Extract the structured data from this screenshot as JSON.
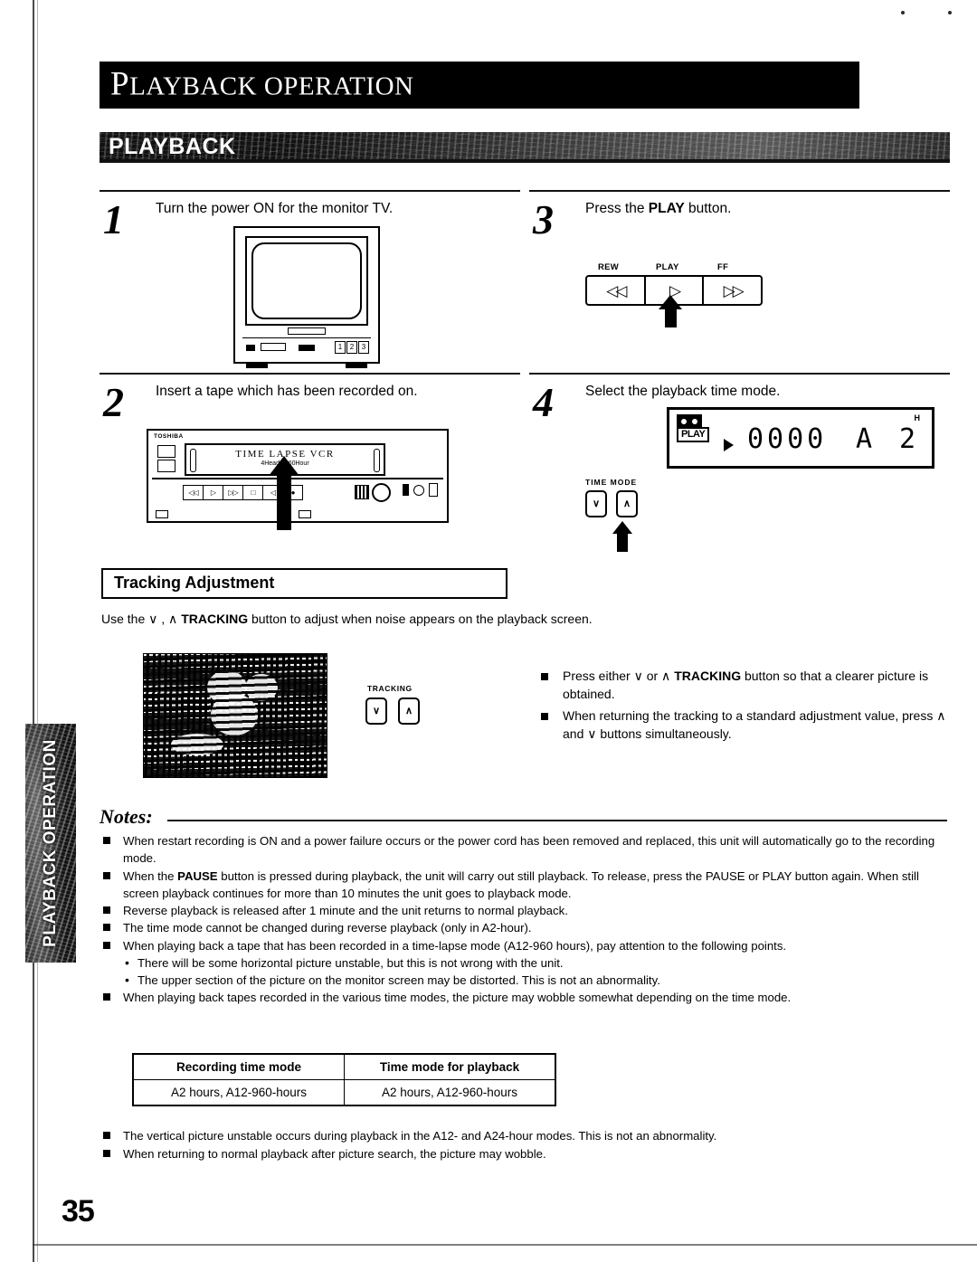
{
  "document": {
    "title": "PLAYBACK OPERATION",
    "title_first_letter": "P",
    "title_rest": "LAYBACK OPERATION",
    "section_bar_label": "PLAYBACK",
    "side_tab_label": "PLAYBACK OPERATION",
    "page_number": "35"
  },
  "steps": [
    {
      "number": "1",
      "caption": "Turn the power ON for the monitor TV.",
      "illustration": "monitor-tv",
      "tv_buttons": [
        "1",
        "2",
        "3"
      ]
    },
    {
      "number": "2",
      "caption": "Insert a tape which has been recorded on.",
      "illustration": "vcr-front-panel",
      "vcr": {
        "brand": "TOSHIBA",
        "slot_title": "TIME LAPSE VCR",
        "slot_subtitle": "4Head / 960Hour"
      }
    },
    {
      "number": "3",
      "caption_prefix": "Press the ",
      "caption_bold": "PLAY",
      "caption_suffix": " button.",
      "illustration": "transport-buttons",
      "transport": {
        "labels": [
          "REW",
          "PLAY",
          "FF"
        ],
        "glyphs": [
          "◁◁",
          "▷",
          "▷▷"
        ]
      }
    },
    {
      "number": "4",
      "caption": "Select the playback time mode.",
      "illustration": "lcd-display",
      "lcd": {
        "play_indicator": "PLAY",
        "counter": "0000",
        "mode_letter": "A",
        "mode_value": "2",
        "mode_unit": "H"
      },
      "time_mode": {
        "label": "TIME MODE",
        "down_glyph": "∨",
        "up_glyph": "∧"
      }
    }
  ],
  "tracking": {
    "heading": "Tracking Adjustment",
    "intro_part1": "Use the  ∨ ,  ∧  ",
    "intro_bold": "TRACKING",
    "intro_part2": " button to adjust when noise appears on the playback screen.",
    "button_label": "TRACKING",
    "down_glyph": "∨",
    "up_glyph": "∧",
    "bullets": [
      {
        "p1": "Press either  ∨  or  ∧  ",
        "b": "TRACKING",
        "p2": " button so that a clearer picture is obtained."
      },
      {
        "p1": "When returning the tracking to a standard adjustment value, press  ∧  and  ∨  buttons simultaneously.",
        "b": "",
        "p2": ""
      }
    ]
  },
  "notes": {
    "title": "Notes:",
    "items": [
      {
        "type": "bullet",
        "p1": "When restart recording is ON and a power failure occurs or the power cord has been removed and replaced, this unit will automatically go to the recording mode.",
        "b": "",
        "p2": ""
      },
      {
        "type": "bullet",
        "p1": "When the ",
        "b": "PAUSE",
        "p2": " button is pressed during playback, the unit will carry out still playback. To release, press the PAUSE or PLAY button again. When still screen playback continues for more than 10 minutes the unit goes to playback mode."
      },
      {
        "type": "bullet",
        "p1": "Reverse playback is released after 1 minute and the unit returns to normal playback.",
        "b": "",
        "p2": ""
      },
      {
        "type": "bullet",
        "p1": "The time mode cannot be changed during reverse playback (only in A2-hour).",
        "b": "",
        "p2": ""
      },
      {
        "type": "bullet",
        "p1": "When playing back a tape that has been recorded in a time-lapse mode (A12-960 hours), pay attention to the following points.",
        "b": "",
        "p2": ""
      },
      {
        "type": "sub",
        "p1": "There will be some horizontal picture unstable, but this is not wrong with the unit.",
        "b": "",
        "p2": ""
      },
      {
        "type": "sub",
        "p1": "The upper section of the picture on the monitor screen may be distorted. This is not an abnormality.",
        "b": "",
        "p2": ""
      },
      {
        "type": "bullet",
        "p1": "When playing back tapes recorded in the various time modes, the picture may wobble somewhat depending on the time mode.",
        "b": "",
        "p2": ""
      }
    ],
    "trailing_items": [
      "The vertical picture unstable occurs during playback in the A12- and A24-hour modes. This is not an abnormality.",
      "When returning to normal playback after picture search, the picture may wobble."
    ]
  },
  "mode_table": {
    "headers": [
      "Recording time mode",
      "Time mode for playback"
    ],
    "rows": [
      [
        "A2 hours, A12-960-hours",
        "A2 hours, A12-960-hours"
      ]
    ]
  }
}
